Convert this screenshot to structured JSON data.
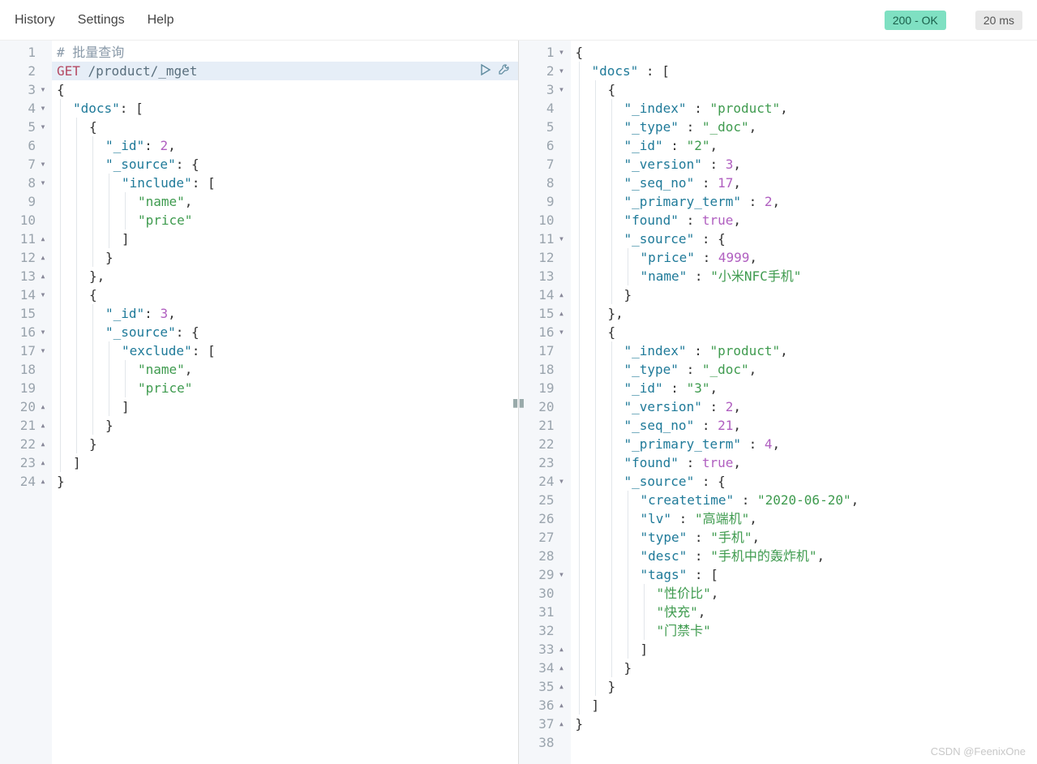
{
  "menu": {
    "history": "History",
    "settings": "Settings",
    "help": "Help"
  },
  "status": {
    "badge": "200 - OK",
    "time": "20 ms"
  },
  "request": {
    "lines": [
      {
        "n": 1,
        "fold": "",
        "indent": 0,
        "tokens": [
          {
            "t": "# 批量查询",
            "c": "comment"
          }
        ]
      },
      {
        "n": 2,
        "fold": "",
        "indent": 0,
        "hl": true,
        "run": true,
        "tokens": [
          {
            "t": "GET",
            "c": "method"
          },
          {
            "t": " ",
            "c": ""
          },
          {
            "t": "/product/_mget",
            "c": "path"
          }
        ]
      },
      {
        "n": 3,
        "fold": "▾",
        "indent": 0,
        "tokens": [
          {
            "t": "{",
            "c": "punct"
          }
        ]
      },
      {
        "n": 4,
        "fold": "▾",
        "indent": 1,
        "tokens": [
          {
            "t": "\"docs\"",
            "c": "key"
          },
          {
            "t": ": [",
            "c": "punct"
          }
        ]
      },
      {
        "n": 5,
        "fold": "▾",
        "indent": 2,
        "tokens": [
          {
            "t": "{",
            "c": "punct"
          }
        ]
      },
      {
        "n": 6,
        "fold": "",
        "indent": 3,
        "tokens": [
          {
            "t": "\"_id\"",
            "c": "key"
          },
          {
            "t": ": ",
            "c": "punct"
          },
          {
            "t": "2",
            "c": "num"
          },
          {
            "t": ",",
            "c": "punct"
          }
        ]
      },
      {
        "n": 7,
        "fold": "▾",
        "indent": 3,
        "tokens": [
          {
            "t": "\"_source\"",
            "c": "key"
          },
          {
            "t": ": {",
            "c": "punct"
          }
        ]
      },
      {
        "n": 8,
        "fold": "▾",
        "indent": 4,
        "tokens": [
          {
            "t": "\"include\"",
            "c": "key"
          },
          {
            "t": ": [",
            "c": "punct"
          }
        ]
      },
      {
        "n": 9,
        "fold": "",
        "indent": 5,
        "tokens": [
          {
            "t": "\"name\"",
            "c": "str"
          },
          {
            "t": ",",
            "c": "punct"
          }
        ]
      },
      {
        "n": 10,
        "fold": "",
        "indent": 5,
        "tokens": [
          {
            "t": "\"price\"",
            "c": "str"
          }
        ]
      },
      {
        "n": 11,
        "fold": "▴",
        "indent": 4,
        "tokens": [
          {
            "t": "]",
            "c": "punct"
          }
        ]
      },
      {
        "n": 12,
        "fold": "▴",
        "indent": 3,
        "tokens": [
          {
            "t": "}",
            "c": "punct"
          }
        ]
      },
      {
        "n": 13,
        "fold": "▴",
        "indent": 2,
        "tokens": [
          {
            "t": "},",
            "c": "punct"
          }
        ]
      },
      {
        "n": 14,
        "fold": "▾",
        "indent": 2,
        "tokens": [
          {
            "t": "{",
            "c": "punct"
          }
        ]
      },
      {
        "n": 15,
        "fold": "",
        "indent": 3,
        "tokens": [
          {
            "t": "\"_id\"",
            "c": "key"
          },
          {
            "t": ": ",
            "c": "punct"
          },
          {
            "t": "3",
            "c": "num"
          },
          {
            "t": ",",
            "c": "punct"
          }
        ]
      },
      {
        "n": 16,
        "fold": "▾",
        "indent": 3,
        "tokens": [
          {
            "t": "\"_source\"",
            "c": "key"
          },
          {
            "t": ": {",
            "c": "punct"
          }
        ]
      },
      {
        "n": 17,
        "fold": "▾",
        "indent": 4,
        "tokens": [
          {
            "t": "\"exclude\"",
            "c": "key"
          },
          {
            "t": ": [",
            "c": "punct"
          }
        ]
      },
      {
        "n": 18,
        "fold": "",
        "indent": 5,
        "tokens": [
          {
            "t": "\"name\"",
            "c": "str"
          },
          {
            "t": ",",
            "c": "punct"
          }
        ]
      },
      {
        "n": 19,
        "fold": "",
        "indent": 5,
        "tokens": [
          {
            "t": "\"price\"",
            "c": "str"
          }
        ]
      },
      {
        "n": 20,
        "fold": "▴",
        "indent": 4,
        "tokens": [
          {
            "t": "]",
            "c": "punct"
          }
        ]
      },
      {
        "n": 21,
        "fold": "▴",
        "indent": 3,
        "tokens": [
          {
            "t": "}",
            "c": "punct"
          }
        ]
      },
      {
        "n": 22,
        "fold": "▴",
        "indent": 2,
        "tokens": [
          {
            "t": "}",
            "c": "punct"
          }
        ]
      },
      {
        "n": 23,
        "fold": "▴",
        "indent": 1,
        "tokens": [
          {
            "t": "]",
            "c": "punct"
          }
        ]
      },
      {
        "n": 24,
        "fold": "▴",
        "indent": 0,
        "tokens": [
          {
            "t": "}",
            "c": "punct"
          }
        ]
      }
    ]
  },
  "response": {
    "lines": [
      {
        "n": 1,
        "fold": "▾",
        "indent": 0,
        "tokens": [
          {
            "t": "{",
            "c": "punct"
          }
        ]
      },
      {
        "n": 2,
        "fold": "▾",
        "indent": 1,
        "tokens": [
          {
            "t": "\"docs\"",
            "c": "key"
          },
          {
            "t": " : [",
            "c": "punct"
          }
        ]
      },
      {
        "n": 3,
        "fold": "▾",
        "indent": 2,
        "tokens": [
          {
            "t": "{",
            "c": "punct"
          }
        ]
      },
      {
        "n": 4,
        "fold": "",
        "indent": 3,
        "tokens": [
          {
            "t": "\"_index\"",
            "c": "key"
          },
          {
            "t": " : ",
            "c": "punct"
          },
          {
            "t": "\"product\"",
            "c": "str"
          },
          {
            "t": ",",
            "c": "punct"
          }
        ]
      },
      {
        "n": 5,
        "fold": "",
        "indent": 3,
        "tokens": [
          {
            "t": "\"_type\"",
            "c": "key"
          },
          {
            "t": " : ",
            "c": "punct"
          },
          {
            "t": "\"_doc\"",
            "c": "str"
          },
          {
            "t": ",",
            "c": "punct"
          }
        ]
      },
      {
        "n": 6,
        "fold": "",
        "indent": 3,
        "tokens": [
          {
            "t": "\"_id\"",
            "c": "key"
          },
          {
            "t": " : ",
            "c": "punct"
          },
          {
            "t": "\"2\"",
            "c": "str"
          },
          {
            "t": ",",
            "c": "punct"
          }
        ]
      },
      {
        "n": 7,
        "fold": "",
        "indent": 3,
        "tokens": [
          {
            "t": "\"_version\"",
            "c": "key"
          },
          {
            "t": " : ",
            "c": "punct"
          },
          {
            "t": "3",
            "c": "num"
          },
          {
            "t": ",",
            "c": "punct"
          }
        ]
      },
      {
        "n": 8,
        "fold": "",
        "indent": 3,
        "tokens": [
          {
            "t": "\"_seq_no\"",
            "c": "key"
          },
          {
            "t": " : ",
            "c": "punct"
          },
          {
            "t": "17",
            "c": "num"
          },
          {
            "t": ",",
            "c": "punct"
          }
        ]
      },
      {
        "n": 9,
        "fold": "",
        "indent": 3,
        "tokens": [
          {
            "t": "\"_primary_term\"",
            "c": "key"
          },
          {
            "t": " : ",
            "c": "punct"
          },
          {
            "t": "2",
            "c": "num"
          },
          {
            "t": ",",
            "c": "punct"
          }
        ]
      },
      {
        "n": 10,
        "fold": "",
        "indent": 3,
        "tokens": [
          {
            "t": "\"found\"",
            "c": "key"
          },
          {
            "t": " : ",
            "c": "punct"
          },
          {
            "t": "true",
            "c": "bool"
          },
          {
            "t": ",",
            "c": "punct"
          }
        ]
      },
      {
        "n": 11,
        "fold": "▾",
        "indent": 3,
        "tokens": [
          {
            "t": "\"_source\"",
            "c": "key"
          },
          {
            "t": " : {",
            "c": "punct"
          }
        ]
      },
      {
        "n": 12,
        "fold": "",
        "indent": 4,
        "tokens": [
          {
            "t": "\"price\"",
            "c": "key"
          },
          {
            "t": " : ",
            "c": "punct"
          },
          {
            "t": "4999",
            "c": "num"
          },
          {
            "t": ",",
            "c": "punct"
          }
        ]
      },
      {
        "n": 13,
        "fold": "",
        "indent": 4,
        "tokens": [
          {
            "t": "\"name\"",
            "c": "key"
          },
          {
            "t": " : ",
            "c": "punct"
          },
          {
            "t": "\"小米NFC手机\"",
            "c": "str"
          }
        ]
      },
      {
        "n": 14,
        "fold": "▴",
        "indent": 3,
        "tokens": [
          {
            "t": "}",
            "c": "punct"
          }
        ]
      },
      {
        "n": 15,
        "fold": "▴",
        "indent": 2,
        "tokens": [
          {
            "t": "},",
            "c": "punct"
          }
        ]
      },
      {
        "n": 16,
        "fold": "▾",
        "indent": 2,
        "tokens": [
          {
            "t": "{",
            "c": "punct"
          }
        ]
      },
      {
        "n": 17,
        "fold": "",
        "indent": 3,
        "tokens": [
          {
            "t": "\"_index\"",
            "c": "key"
          },
          {
            "t": " : ",
            "c": "punct"
          },
          {
            "t": "\"product\"",
            "c": "str"
          },
          {
            "t": ",",
            "c": "punct"
          }
        ]
      },
      {
        "n": 18,
        "fold": "",
        "indent": 3,
        "tokens": [
          {
            "t": "\"_type\"",
            "c": "key"
          },
          {
            "t": " : ",
            "c": "punct"
          },
          {
            "t": "\"_doc\"",
            "c": "str"
          },
          {
            "t": ",",
            "c": "punct"
          }
        ]
      },
      {
        "n": 19,
        "fold": "",
        "indent": 3,
        "tokens": [
          {
            "t": "\"_id\"",
            "c": "key"
          },
          {
            "t": " : ",
            "c": "punct"
          },
          {
            "t": "\"3\"",
            "c": "str"
          },
          {
            "t": ",",
            "c": "punct"
          }
        ]
      },
      {
        "n": 20,
        "fold": "",
        "indent": 3,
        "tokens": [
          {
            "t": "\"_version\"",
            "c": "key"
          },
          {
            "t": " : ",
            "c": "punct"
          },
          {
            "t": "2",
            "c": "num"
          },
          {
            "t": ",",
            "c": "punct"
          }
        ]
      },
      {
        "n": 21,
        "fold": "",
        "indent": 3,
        "tokens": [
          {
            "t": "\"_seq_no\"",
            "c": "key"
          },
          {
            "t": " : ",
            "c": "punct"
          },
          {
            "t": "21",
            "c": "num"
          },
          {
            "t": ",",
            "c": "punct"
          }
        ]
      },
      {
        "n": 22,
        "fold": "",
        "indent": 3,
        "tokens": [
          {
            "t": "\"_primary_term\"",
            "c": "key"
          },
          {
            "t": " : ",
            "c": "punct"
          },
          {
            "t": "4",
            "c": "num"
          },
          {
            "t": ",",
            "c": "punct"
          }
        ]
      },
      {
        "n": 23,
        "fold": "",
        "indent": 3,
        "tokens": [
          {
            "t": "\"found\"",
            "c": "key"
          },
          {
            "t": " : ",
            "c": "punct"
          },
          {
            "t": "true",
            "c": "bool"
          },
          {
            "t": ",",
            "c": "punct"
          }
        ]
      },
      {
        "n": 24,
        "fold": "▾",
        "indent": 3,
        "tokens": [
          {
            "t": "\"_source\"",
            "c": "key"
          },
          {
            "t": " : {",
            "c": "punct"
          }
        ]
      },
      {
        "n": 25,
        "fold": "",
        "indent": 4,
        "tokens": [
          {
            "t": "\"createtime\"",
            "c": "key"
          },
          {
            "t": " : ",
            "c": "punct"
          },
          {
            "t": "\"2020-06-20\"",
            "c": "str"
          },
          {
            "t": ",",
            "c": "punct"
          }
        ]
      },
      {
        "n": 26,
        "fold": "",
        "indent": 4,
        "tokens": [
          {
            "t": "\"lv\"",
            "c": "key"
          },
          {
            "t": " : ",
            "c": "punct"
          },
          {
            "t": "\"高端机\"",
            "c": "str"
          },
          {
            "t": ",",
            "c": "punct"
          }
        ]
      },
      {
        "n": 27,
        "fold": "",
        "indent": 4,
        "tokens": [
          {
            "t": "\"type\"",
            "c": "key"
          },
          {
            "t": " : ",
            "c": "punct"
          },
          {
            "t": "\"手机\"",
            "c": "str"
          },
          {
            "t": ",",
            "c": "punct"
          }
        ]
      },
      {
        "n": 28,
        "fold": "",
        "indent": 4,
        "tokens": [
          {
            "t": "\"desc\"",
            "c": "key"
          },
          {
            "t": " : ",
            "c": "punct"
          },
          {
            "t": "\"手机中的轰炸机\"",
            "c": "str"
          },
          {
            "t": ",",
            "c": "punct"
          }
        ]
      },
      {
        "n": 29,
        "fold": "▾",
        "indent": 4,
        "tokens": [
          {
            "t": "\"tags\"",
            "c": "key"
          },
          {
            "t": " : [",
            "c": "punct"
          }
        ]
      },
      {
        "n": 30,
        "fold": "",
        "indent": 5,
        "tokens": [
          {
            "t": "\"性价比\"",
            "c": "str"
          },
          {
            "t": ",",
            "c": "punct"
          }
        ]
      },
      {
        "n": 31,
        "fold": "",
        "indent": 5,
        "tokens": [
          {
            "t": "\"快充\"",
            "c": "str"
          },
          {
            "t": ",",
            "c": "punct"
          }
        ]
      },
      {
        "n": 32,
        "fold": "",
        "indent": 5,
        "tokens": [
          {
            "t": "\"门禁卡\"",
            "c": "str"
          }
        ]
      },
      {
        "n": 33,
        "fold": "▴",
        "indent": 4,
        "tokens": [
          {
            "t": "]",
            "c": "punct"
          }
        ]
      },
      {
        "n": 34,
        "fold": "▴",
        "indent": 3,
        "tokens": [
          {
            "t": "}",
            "c": "punct"
          }
        ]
      },
      {
        "n": 35,
        "fold": "▴",
        "indent": 2,
        "tokens": [
          {
            "t": "}",
            "c": "punct"
          }
        ]
      },
      {
        "n": 36,
        "fold": "▴",
        "indent": 1,
        "tokens": [
          {
            "t": "]",
            "c": "punct"
          }
        ]
      },
      {
        "n": 37,
        "fold": "▴",
        "indent": 0,
        "tokens": [
          {
            "t": "}",
            "c": "punct"
          }
        ]
      },
      {
        "n": 38,
        "fold": "",
        "indent": 0,
        "tokens": []
      }
    ]
  },
  "watermark": "CSDN @FeenixOne"
}
